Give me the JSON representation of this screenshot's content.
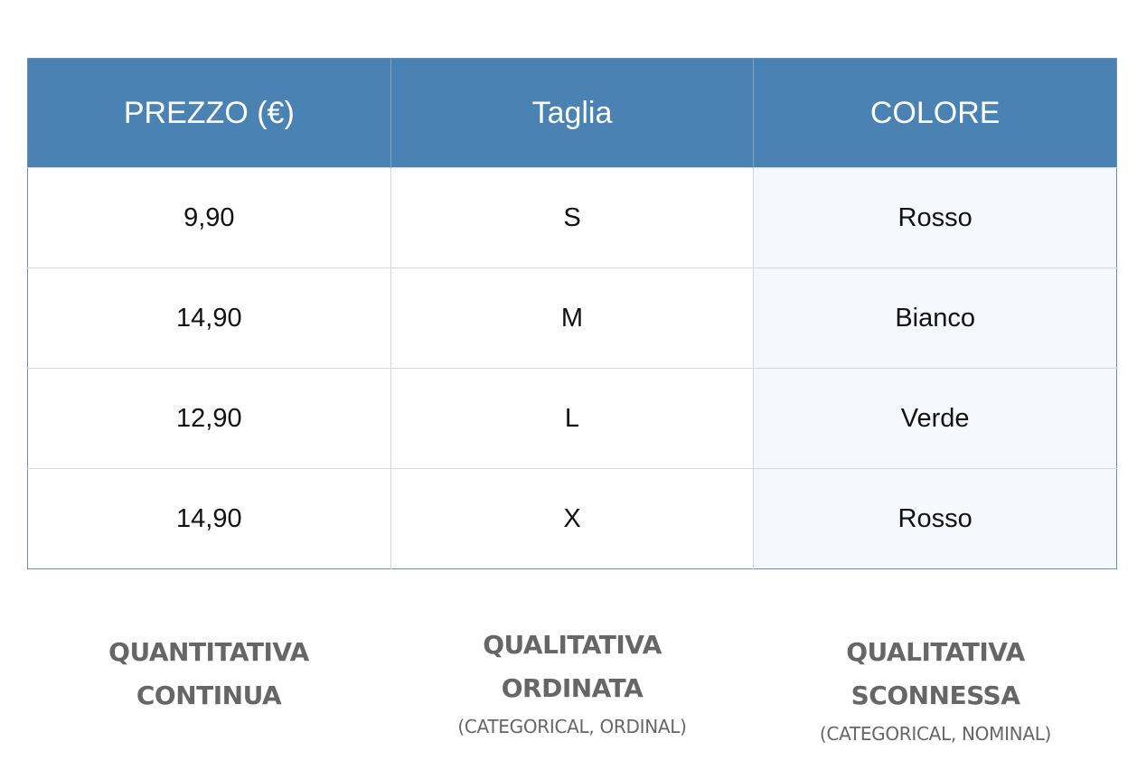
{
  "table": {
    "headers": [
      "PREZZO (€)",
      "Taglia",
      "COLORE"
    ],
    "rows": [
      [
        "9,90",
        "S",
        "Rosso"
      ],
      [
        "14,90",
        "M",
        "Bianco"
      ],
      [
        "12,90",
        "L",
        "Verde"
      ],
      [
        "14,90",
        "X",
        "Rosso"
      ]
    ],
    "header_color": "#4a82b4"
  },
  "labels": [
    {
      "line1": "QUANTITATIVA",
      "line2": "CONTINUA",
      "sub": ""
    },
    {
      "line1": "QUALITATIVA",
      "line2": "ORDINATA",
      "sub": "(CATEGORICAL, ORDINAL)"
    },
    {
      "line1": "QUALITATIVA",
      "line2": "SCONNESSA",
      "sub": "(CATEGORICAL,  NOMINAL)"
    }
  ]
}
